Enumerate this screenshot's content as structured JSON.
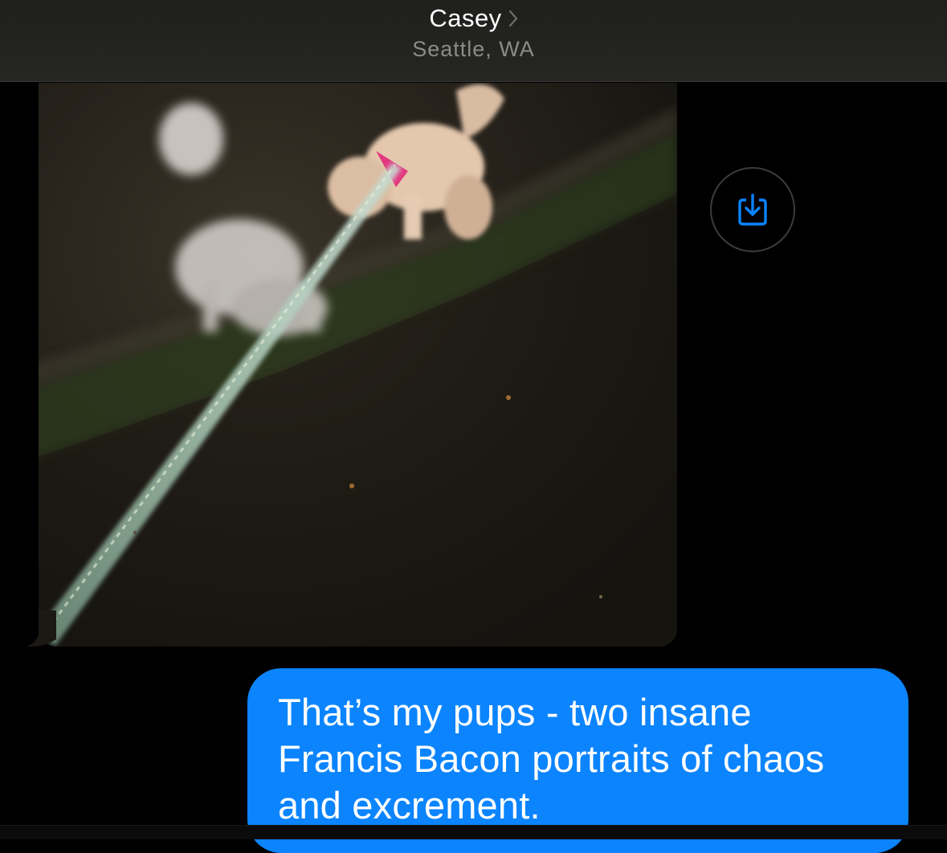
{
  "header": {
    "contact_name": "Casey",
    "location": "Seattle, WA",
    "chevron_icon": "chevron-right-icon"
  },
  "photo_message": {
    "save_icon": "save-download-icon",
    "accent_color": "#0a84ff"
  },
  "outgoing_message": {
    "text": "That’s my pups - two insane Francis Bacon portraits of chaos and excrement.",
    "bubble_color": "#0b84fe"
  }
}
